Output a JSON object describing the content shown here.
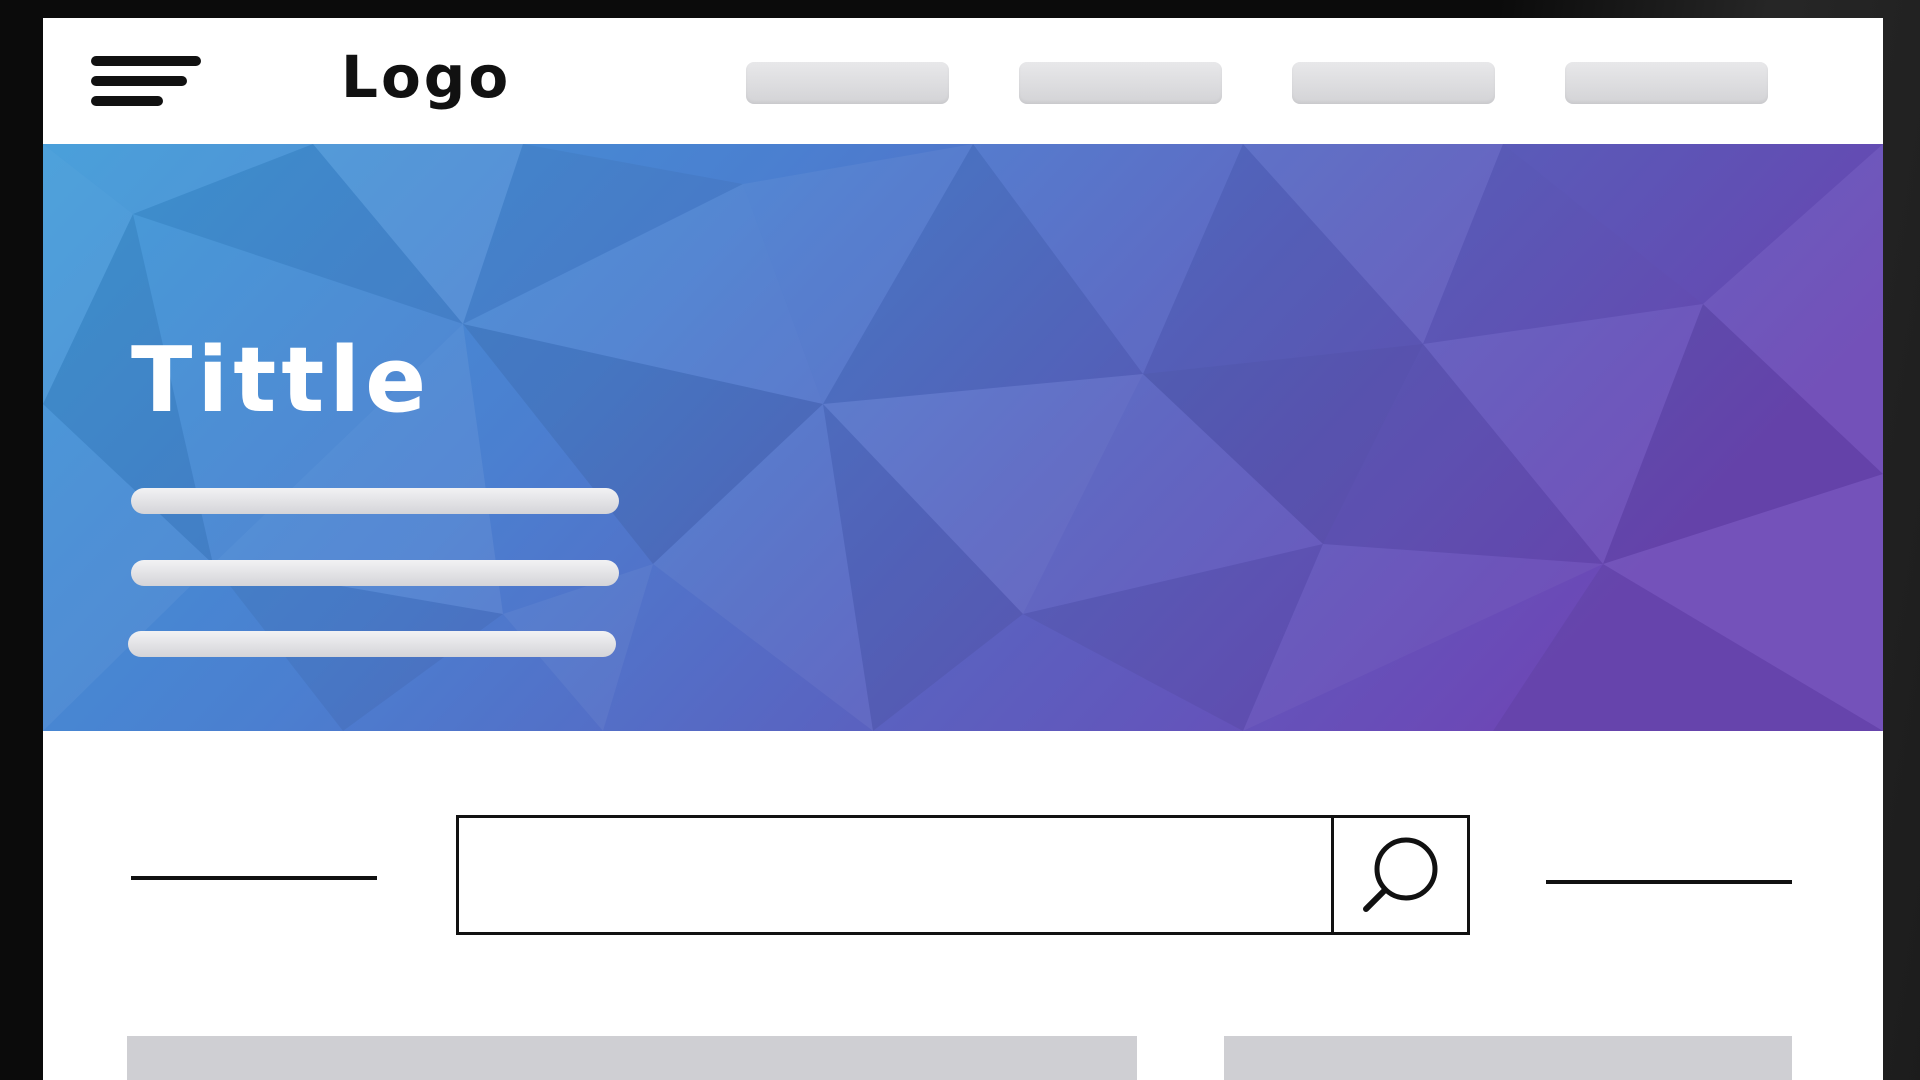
{
  "header": {
    "logo_text": "Logo",
    "menu_icon": "hamburger-menu-icon",
    "nav_items": [
      "",
      "",
      "",
      ""
    ]
  },
  "hero": {
    "title": "Tittle",
    "text_lines": [
      "",
      "",
      ""
    ],
    "gradient_colors": [
      "#3f9ad8",
      "#4b7fd0",
      "#5a62c0",
      "#6c48b6"
    ]
  },
  "search": {
    "value": "",
    "placeholder": "",
    "button_icon": "search-icon"
  },
  "colors": {
    "nav_placeholder": "#dcdcdf",
    "card_placeholder": "#cfcfd3",
    "outline": "#111111"
  }
}
